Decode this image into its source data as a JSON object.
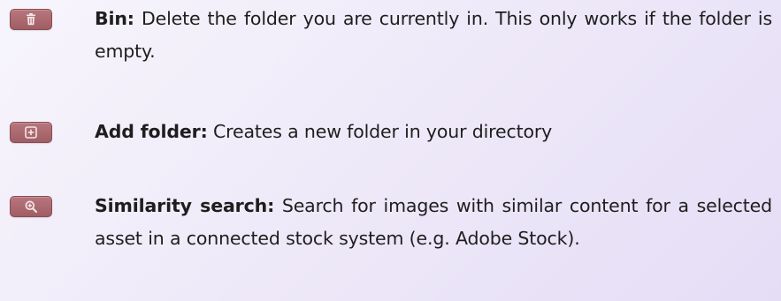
{
  "entries": [
    {
      "icon": "trash-icon",
      "label": "Bin:",
      "description": " Delete the folder you are currently in. This only works if the folder is empty."
    },
    {
      "icon": "add-folder-icon",
      "label": "Add folder:",
      "description": " Creates a new folder in your directory"
    },
    {
      "icon": "magnify-icon",
      "label": "Similarity search:",
      "description": " Search for images with similar content for a selected asset in a connected stock system (e.g. Adobe Stock)."
    }
  ],
  "colors": {
    "button": "#a8666c",
    "button_border": "#8c4a51",
    "icon": "#f3e6e8",
    "text": "#1e1e1e",
    "background_start": "#f7f5fc",
    "background_end": "#e5ddf6"
  }
}
